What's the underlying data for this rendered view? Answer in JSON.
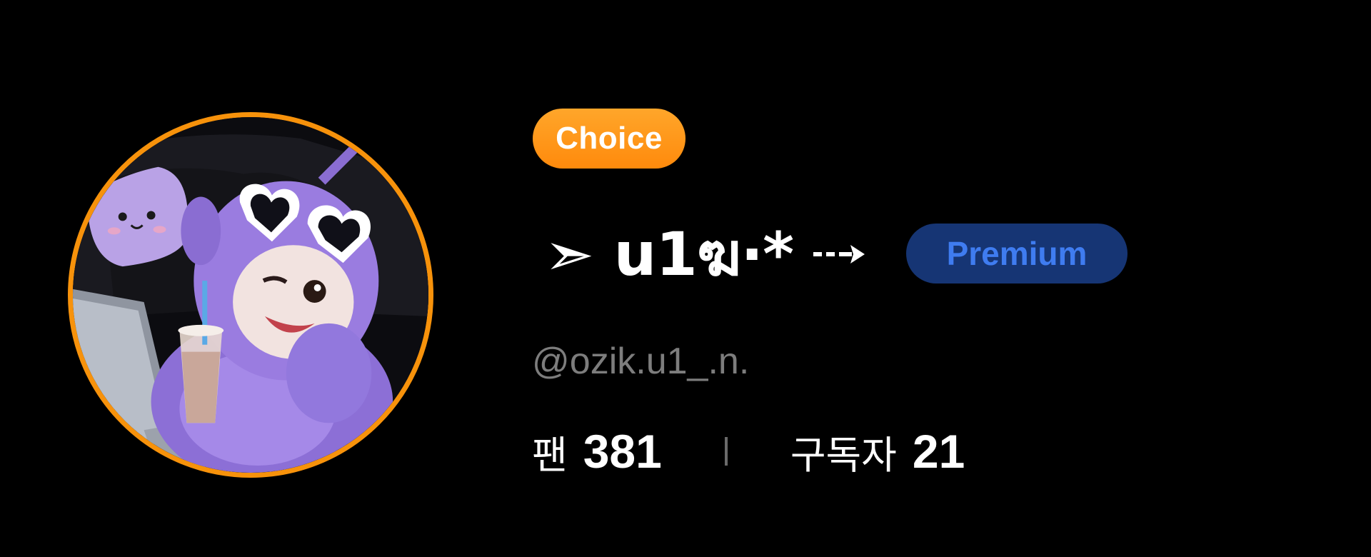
{
  "profile": {
    "badge_choice": "Choice",
    "display_name": "➣ u1ฆ·*",
    "badge_premium": "Premium",
    "handle": "@ozik.u1_.n.",
    "stats": {
      "fans_label": "팬",
      "fans_value": "381",
      "subscribers_label": "구독자",
      "subscribers_value": "21"
    }
  },
  "colors": {
    "background": "#000000",
    "avatar_ring": "#f7920b",
    "choice_badge": "#ff9614",
    "premium_badge_bg": "#163574",
    "premium_badge_text": "#3f7cf0",
    "handle_text": "#7d7d7d"
  },
  "icons": {
    "avatar": "profile-avatar-purple-plush",
    "name_arrow": "dashed-right-arrow-icon"
  }
}
